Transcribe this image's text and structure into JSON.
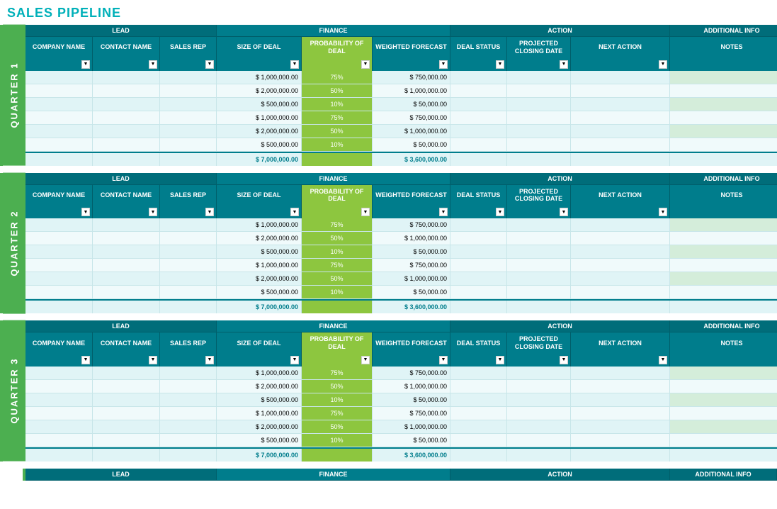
{
  "title": "SALES PIPELINE",
  "colors": {
    "teal_dark": "#006d7a",
    "teal_mid": "#007d8c",
    "green_accent": "#8dc63f",
    "green_quarter": "#4caf50",
    "light_blue1": "#e0f4f6",
    "light_blue2": "#f0fafb"
  },
  "group_headers": {
    "lead": "LEAD",
    "finance": "FINANCE",
    "action": "ACTION",
    "additional_info": "ADDITIONAL INFO"
  },
  "col_headers": {
    "company_name": "COMPANY NAME",
    "contact_name": "CONTACT NAME",
    "sales_rep": "SALES REP",
    "size_of_deal": "SIZE OF DEAL",
    "probability_of_deal": "PROBABILITY OF DEAL",
    "weighted_forecast": "WEIGHTED FORECAST",
    "deal_status": "DEAL STATUS",
    "projected_closing_date": "PROJECTED CLOSING DATE",
    "next_action": "NEXT ACTION",
    "notes": "NOTES"
  },
  "quarters": [
    {
      "label": "QUARTER 1",
      "rows": [
        {
          "size": "$ 1,000,000.00",
          "prob": "75%",
          "weighted": "$ 750,000.00"
        },
        {
          "size": "$ 2,000,000.00",
          "prob": "50%",
          "weighted": "$ 1,000,000.00"
        },
        {
          "size": "$ 500,000.00",
          "prob": "10%",
          "weighted": "$ 50,000.00"
        },
        {
          "size": "$ 1,000,000.00",
          "prob": "75%",
          "weighted": "$ 750,000.00"
        },
        {
          "size": "$ 2,000,000.00",
          "prob": "50%",
          "weighted": "$ 1,000,000.00"
        },
        {
          "size": "$ 500,000.00",
          "prob": "10%",
          "weighted": "$ 50,000.00"
        }
      ],
      "total_size": "$ 7,000,000.00",
      "total_weighted": "$ 3,600,000.00"
    },
    {
      "label": "QUARTER 2",
      "rows": [
        {
          "size": "$ 1,000,000.00",
          "prob": "75%",
          "weighted": "$ 750,000.00"
        },
        {
          "size": "$ 2,000,000.00",
          "prob": "50%",
          "weighted": "$ 1,000,000.00"
        },
        {
          "size": "$ 500,000.00",
          "prob": "10%",
          "weighted": "$ 50,000.00"
        },
        {
          "size": "$ 1,000,000.00",
          "prob": "75%",
          "weighted": "$ 750,000.00"
        },
        {
          "size": "$ 2,000,000.00",
          "prob": "50%",
          "weighted": "$ 1,000,000.00"
        },
        {
          "size": "$ 500,000.00",
          "prob": "10%",
          "weighted": "$ 50,000.00"
        }
      ],
      "total_size": "$ 7,000,000.00",
      "total_weighted": "$ 3,600,000.00"
    },
    {
      "label": "QUARTER 3",
      "rows": [
        {
          "size": "$ 1,000,000.00",
          "prob": "75%",
          "weighted": "$ 750,000.00"
        },
        {
          "size": "$ 2,000,000.00",
          "prob": "50%",
          "weighted": "$ 1,000,000.00"
        },
        {
          "size": "$ 500,000.00",
          "prob": "10%",
          "weighted": "$ 50,000.00"
        },
        {
          "size": "$ 1,000,000.00",
          "prob": "75%",
          "weighted": "$ 750,000.00"
        },
        {
          "size": "$ 2,000,000.00",
          "prob": "50%",
          "weighted": "$ 1,000,000.00"
        },
        {
          "size": "$ 500,000.00",
          "prob": "10%",
          "weighted": "$ 50,000.00"
        }
      ],
      "total_size": "$ 7,000,000.00",
      "total_weighted": "$ 3,600,000.00"
    }
  ],
  "bottom_header": {
    "lead": "LEAD",
    "finance": "FINANCE",
    "action": "ACTION",
    "additional_info": "ADDITIONAL INFO"
  }
}
